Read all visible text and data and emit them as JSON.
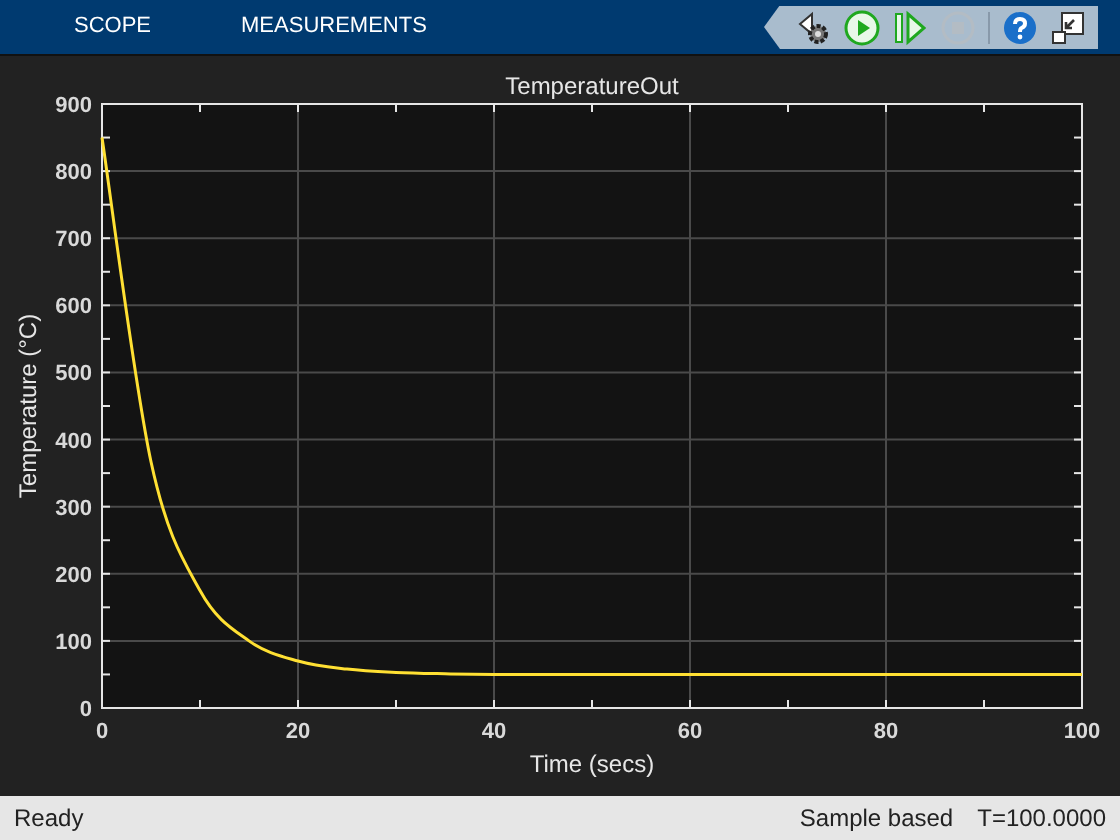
{
  "tabs": [
    {
      "label": "SCOPE"
    },
    {
      "label": "MEASUREMENTS"
    }
  ],
  "toolbar": [
    {
      "kind": "settings",
      "disabled": false
    },
    {
      "kind": "run",
      "disabled": false
    },
    {
      "kind": "step",
      "disabled": false
    },
    {
      "kind": "stop",
      "disabled": true
    },
    {
      "kind": "help",
      "disabled": false
    },
    {
      "kind": "undock",
      "disabled": false
    }
  ],
  "chart_data": {
    "type": "line",
    "title": "TemperatureOut",
    "xlabel": "Time (secs)",
    "ylabel": "Temperature (°C)",
    "x": [
      0,
      5,
      10,
      15,
      20,
      25,
      30,
      35,
      40,
      50,
      60,
      70,
      80,
      90,
      100
    ],
    "series": [
      {
        "color": "#ffe033",
        "values": [
          850,
          367,
          175,
          100,
          70,
          58,
          53,
          51,
          50,
          50,
          50,
          50,
          50,
          50,
          50
        ]
      }
    ],
    "grid": true,
    "xlim": [
      0,
      100
    ],
    "ylim": [
      0,
      900
    ],
    "xticks": [
      0,
      20,
      40,
      60,
      80,
      100
    ],
    "yticks": [
      0,
      100,
      200,
      300,
      400,
      500,
      600,
      700,
      800,
      900
    ]
  },
  "status_bar": {
    "left": "Ready",
    "mode": "Sample based",
    "time": "T=100.0000"
  }
}
